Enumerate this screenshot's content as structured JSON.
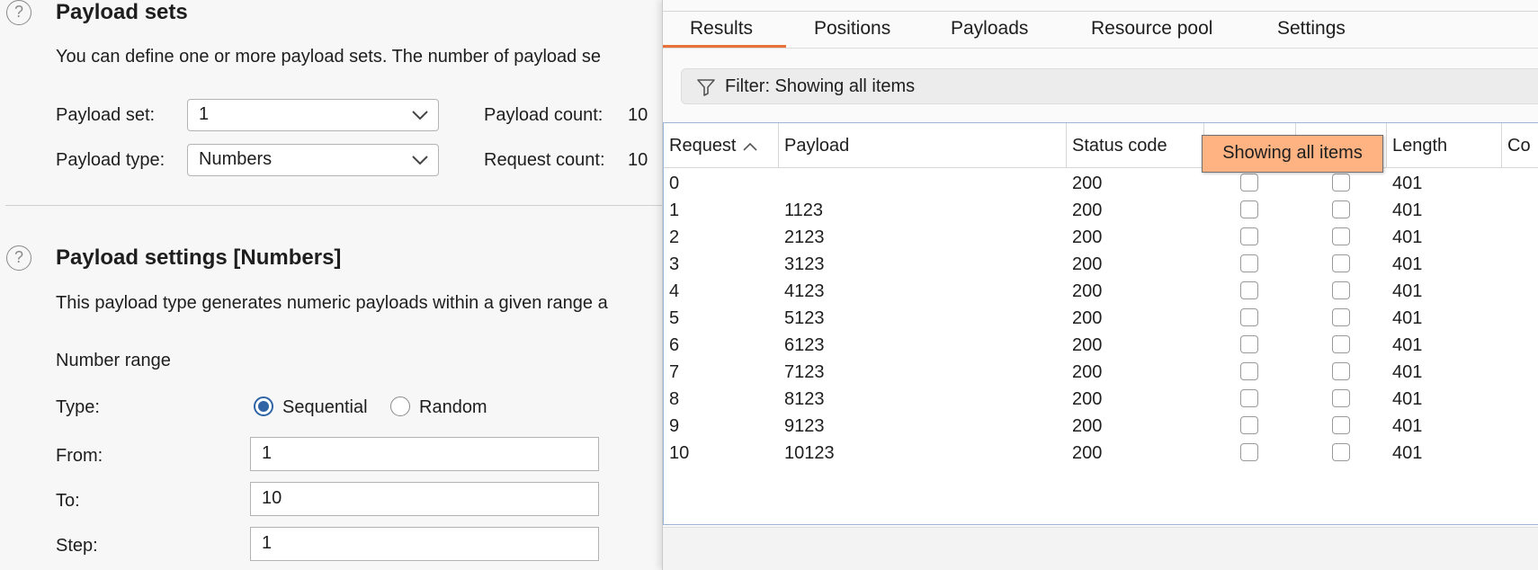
{
  "payload_sets": {
    "help_icon": "?",
    "title": "Payload sets",
    "description": "You can define one or more payload sets. The number of payload se",
    "set_label": "Payload set:",
    "set_value": "1",
    "payload_count_label": "Payload count:",
    "payload_count_value": "10",
    "type_label": "Payload type:",
    "type_value": "Numbers",
    "request_count_label": "Request count:",
    "request_count_value": "10"
  },
  "payload_settings": {
    "help_icon": "?",
    "title": "Payload settings [Numbers]",
    "description": "This payload type generates numeric payloads within a given range a",
    "number_range_label": "Number range",
    "type_label": "Type:",
    "sequential_label": "Sequential",
    "random_label": "Random",
    "selected_type": "Sequential",
    "from_label": "From:",
    "from_value": "1",
    "to_label": "To:",
    "to_value": "10",
    "step_label": "Step:",
    "step_value": "1"
  },
  "tabs": [
    {
      "label": "Results",
      "active": true
    },
    {
      "label": "Positions"
    },
    {
      "label": "Payloads"
    },
    {
      "label": "Resource pool"
    },
    {
      "label": "Settings"
    }
  ],
  "filter": {
    "text": "Filter: Showing all items",
    "icon": "filter-icon"
  },
  "table": {
    "columns": [
      "Request",
      "Payload",
      "Status code",
      "",
      "",
      "Length",
      "Co"
    ],
    "sort_column": "Request",
    "sort_direction": "ascending",
    "rows": [
      {
        "request": "0",
        "payload": "",
        "status": "200",
        "length": "401"
      },
      {
        "request": "1",
        "payload": "1123",
        "status": "200",
        "length": "401"
      },
      {
        "request": "2",
        "payload": "2123",
        "status": "200",
        "length": "401"
      },
      {
        "request": "3",
        "payload": "3123",
        "status": "200",
        "length": "401"
      },
      {
        "request": "4",
        "payload": "4123",
        "status": "200",
        "length": "401"
      },
      {
        "request": "5",
        "payload": "5123",
        "status": "200",
        "length": "401"
      },
      {
        "request": "6",
        "payload": "6123",
        "status": "200",
        "length": "401"
      },
      {
        "request": "7",
        "payload": "7123",
        "status": "200",
        "length": "401"
      },
      {
        "request": "8",
        "payload": "8123",
        "status": "200",
        "length": "401"
      },
      {
        "request": "9",
        "payload": "9123",
        "status": "200",
        "length": "401"
      },
      {
        "request": "10",
        "payload": "10123",
        "status": "200",
        "length": "401"
      }
    ]
  },
  "tooltip": {
    "text": "Showing all items"
  },
  "colors": {
    "accent_tab": "#e8703a",
    "radio_selected": "#2f64a5",
    "tooltip_bg": "#ffb383",
    "table_border": "#9db6d8"
  }
}
